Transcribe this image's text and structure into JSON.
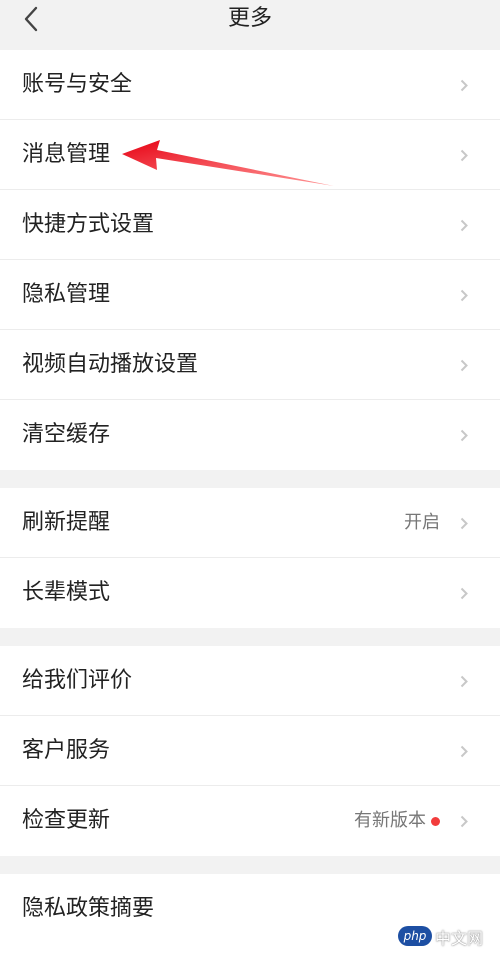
{
  "header": {
    "title": "更多",
    "back_icon": "chevron-left-icon"
  },
  "colors": {
    "background": "#f2f2f2",
    "row_background": "#ffffff",
    "text": "#222222",
    "secondary_text": "#777777",
    "chevron": "#c8c8c8",
    "badge_dot": "#f23c3c",
    "annotation_arrow": "#e60012",
    "watermark_logo": "#1d4fa3"
  },
  "groups": [
    {
      "items": [
        {
          "label": "账号与安全"
        },
        {
          "label": "消息管理"
        },
        {
          "label": "快捷方式设置"
        },
        {
          "label": "隐私管理"
        },
        {
          "label": "视频自动播放设置"
        },
        {
          "label": "清空缓存"
        }
      ]
    },
    {
      "items": [
        {
          "label": "刷新提醒",
          "value": "开启"
        },
        {
          "label": "长辈模式"
        }
      ]
    },
    {
      "items": [
        {
          "label": "给我们评价"
        },
        {
          "label": "客户服务"
        },
        {
          "label": "检查更新",
          "value": "有新版本",
          "badge": true
        }
      ]
    },
    {
      "items": [
        {
          "label": "隐私政策摘要"
        }
      ]
    }
  ],
  "watermark": {
    "logo_text": "php",
    "site_text": "中文网"
  }
}
